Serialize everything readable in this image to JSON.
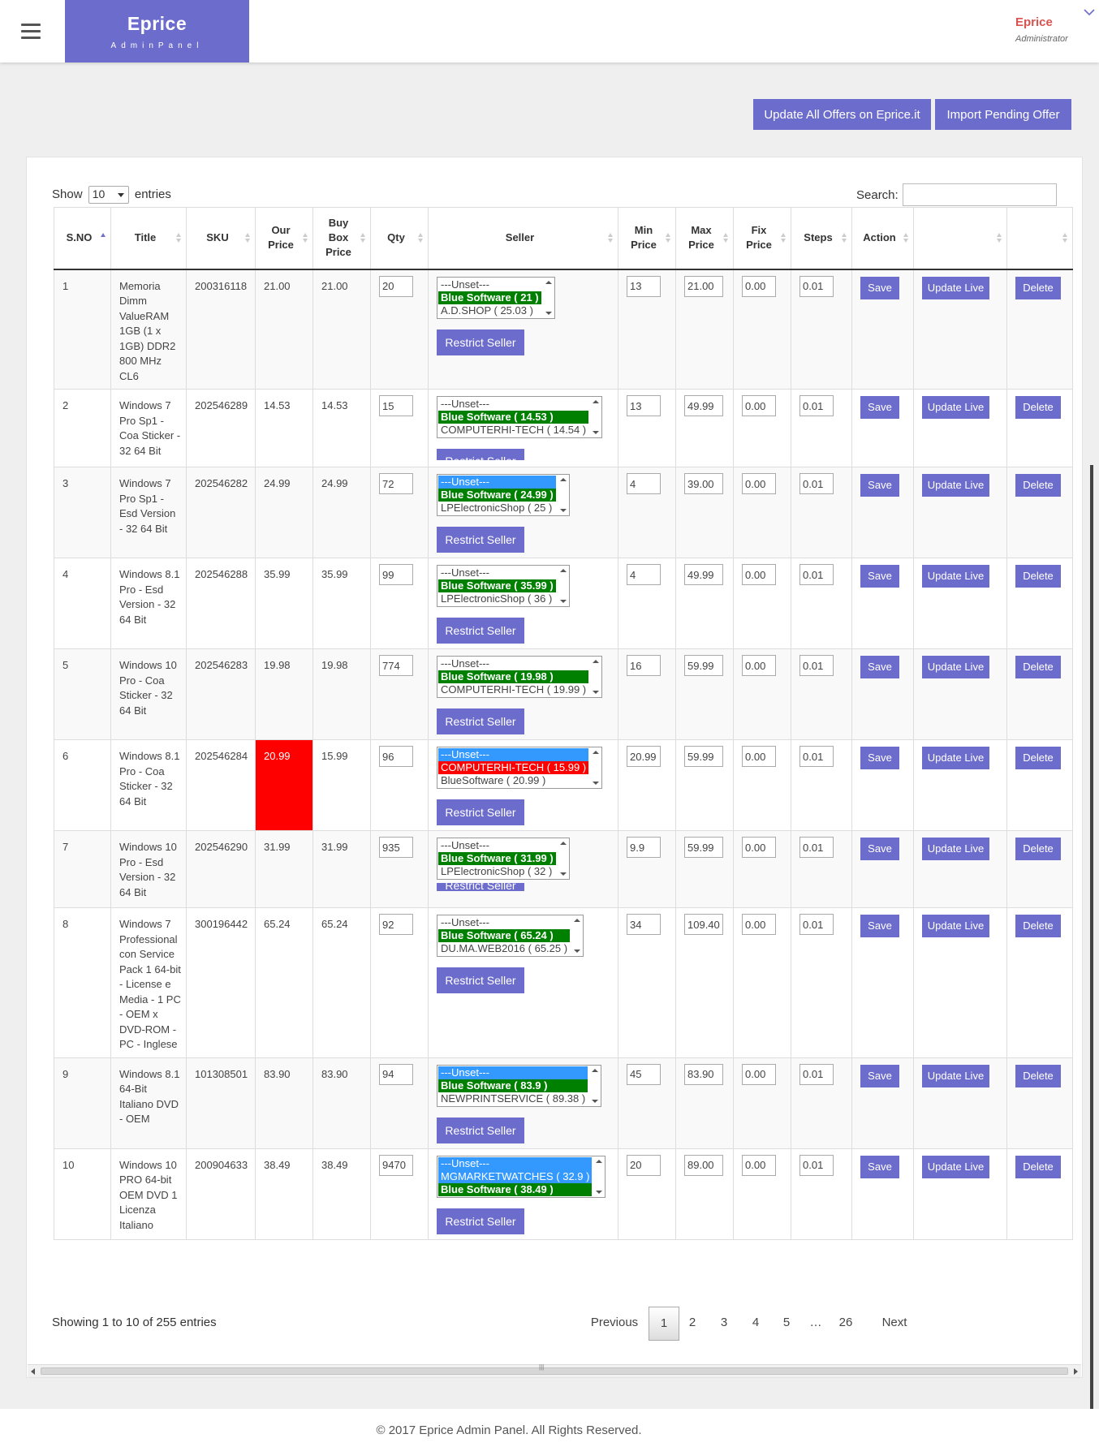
{
  "header": {
    "brand": "Eprice",
    "brand_sub": "AdminPanel",
    "user_name": "Eprice",
    "user_role": "Administrator"
  },
  "toolbar": {
    "update_all_label": "Update All Offers on Eprice.it",
    "import_pending_label": "Import Pending Offer"
  },
  "table_controls": {
    "show_label": "Show",
    "entries_label": "entries",
    "page_size": "10",
    "search_label": "Search:",
    "search_value": ""
  },
  "columns": [
    "S.NO",
    "Title",
    "SKU",
    "Our Price",
    "Buy Box Price",
    "Qty",
    "Seller",
    "Min Price",
    "Max Price",
    "Fix Price",
    "Steps",
    "Action",
    "",
    ""
  ],
  "buttons": {
    "save": "Save",
    "update_live": "Update Live",
    "delete": "Delete",
    "restrict": "Restrict Seller"
  },
  "rows": [
    {
      "sno": "1",
      "title": "Memoria Dimm ValueRAM 1GB (1 x 1GB) DDR2 800 MHz CL6",
      "sku": "200316118",
      "our_price": "21.00",
      "buy_box": "21.00",
      "qty": "20",
      "sellers": [
        "---Unset---",
        "Blue Software ( 21 )",
        "A.D.SHOP ( 25.03 )"
      ],
      "min": "13",
      "max": "21.00",
      "fix": "0.00",
      "steps": "0.01"
    },
    {
      "sno": "2",
      "title": "Windows 7 Pro Sp1 - Coa Sticker - 32 64 Bit",
      "sku": "202546289",
      "our_price": "14.53",
      "buy_box": "14.53",
      "qty": "15",
      "sellers": [
        "---Unset---",
        "Blue Software ( 14.53 )",
        "COMPUTERHI-TECH ( 14.54 )"
      ],
      "min": "13",
      "max": "49.99",
      "fix": "0.00",
      "steps": "0.01"
    },
    {
      "sno": "3",
      "title": "Windows 7 Pro Sp1 - Esd Version - 32 64 Bit",
      "sku": "202546282",
      "our_price": "24.99",
      "buy_box": "24.99",
      "qty": "72",
      "sellers": [
        "---Unset---",
        "Blue Software ( 24.99 )",
        "LPElectronicShop ( 25 )"
      ],
      "min": "4",
      "max": "39.00",
      "fix": "0.00",
      "steps": "0.01"
    },
    {
      "sno": "4",
      "title": "Windows 8.1 Pro - Esd Version - 32 64 Bit",
      "sku": "202546288",
      "our_price": "35.99",
      "buy_box": "35.99",
      "qty": "99",
      "sellers": [
        "---Unset---",
        "Blue Software ( 35.99 )",
        "LPElectronicShop ( 36 )"
      ],
      "min": "4",
      "max": "49.99",
      "fix": "0.00",
      "steps": "0.01"
    },
    {
      "sno": "5",
      "title": "Windows 10 Pro - Coa Sticker - 32 64 Bit",
      "sku": "202546283",
      "our_price": "19.98",
      "buy_box": "19.98",
      "qty": "774",
      "sellers": [
        "---Unset---",
        "Blue Software ( 19.98 )",
        "COMPUTERHI-TECH ( 19.99 )"
      ],
      "min": "16",
      "max": "59.99",
      "fix": "0.00",
      "steps": "0.01"
    },
    {
      "sno": "6",
      "title": "Windows 8.1 Pro - Coa Sticker - 32 64 Bit",
      "sku": "202546284",
      "our_price": "20.99",
      "buy_box": "15.99",
      "qty": "96",
      "sellers": [
        "---Unset---",
        "COMPUTERHI-TECH ( 15.99 )",
        "BlueSoftware ( 20.99 )"
      ],
      "min": "20.99",
      "max": "59.99",
      "fix": "0.00",
      "steps": "0.01"
    },
    {
      "sno": "7",
      "title": "Windows 10 Pro - Esd Version - 32 64 Bit",
      "sku": "202546290",
      "our_price": "31.99",
      "buy_box": "31.99",
      "qty": "935",
      "sellers": [
        "---Unset---",
        "Blue Software ( 31.99 )",
        "LPElectronicShop ( 32 )"
      ],
      "min": "9.9",
      "max": "59.99",
      "fix": "0.00",
      "steps": "0.01"
    },
    {
      "sno": "8",
      "title": "Windows 7 Professional con Service Pack 1 64-bit - License e Media - 1 PC - OEM x DVD-ROM - PC - Inglese",
      "sku": "300196442",
      "our_price": "65.24",
      "buy_box": "65.24",
      "qty": "92",
      "sellers": [
        "---Unset---",
        "Blue Software ( 65.24 )",
        "DU.MA.WEB2016 ( 65.25 )"
      ],
      "min": "34",
      "max": "109.40",
      "fix": "0.00",
      "steps": "0.01"
    },
    {
      "sno": "9",
      "title": "Windows 8.1 64-Bit Italiano DVD - OEM",
      "sku": "101308501",
      "our_price": "83.90",
      "buy_box": "83.90",
      "qty": "94",
      "sellers": [
        "---Unset---",
        "Blue Software ( 83.9 )",
        "NEWPRINTSERVICE ( 89.38 )"
      ],
      "min": "45",
      "max": "83.90",
      "fix": "0.00",
      "steps": "0.01"
    },
    {
      "sno": "10",
      "title": "Windows 10 PRO 64-bit OEM DVD 1 Licenza Italiano",
      "sku": "200904633",
      "our_price": "38.49",
      "buy_box": "38.49",
      "qty": "9470",
      "sellers": [
        "---Unset---",
        "MGMARKETWATCHES ( 32.9 )",
        "Blue Software ( 38.49 )"
      ],
      "min": "20",
      "max": "89.00",
      "fix": "0.00",
      "steps": "0.01"
    }
  ],
  "pagination": {
    "info": "Showing 1 to 10 of 255 entries",
    "previous": "Previous",
    "pages": [
      "1",
      "2",
      "3",
      "4",
      "5",
      "…",
      "26"
    ],
    "next": "Next",
    "current": "1"
  },
  "footer": {
    "text": "© 2017 Eprice Admin Panel. All Rights Reserved."
  },
  "colors": {
    "accent": "#6c6ccc",
    "alert": "#ff0000",
    "buybox_green": "#008000",
    "selected_blue": "#3399ff"
  }
}
